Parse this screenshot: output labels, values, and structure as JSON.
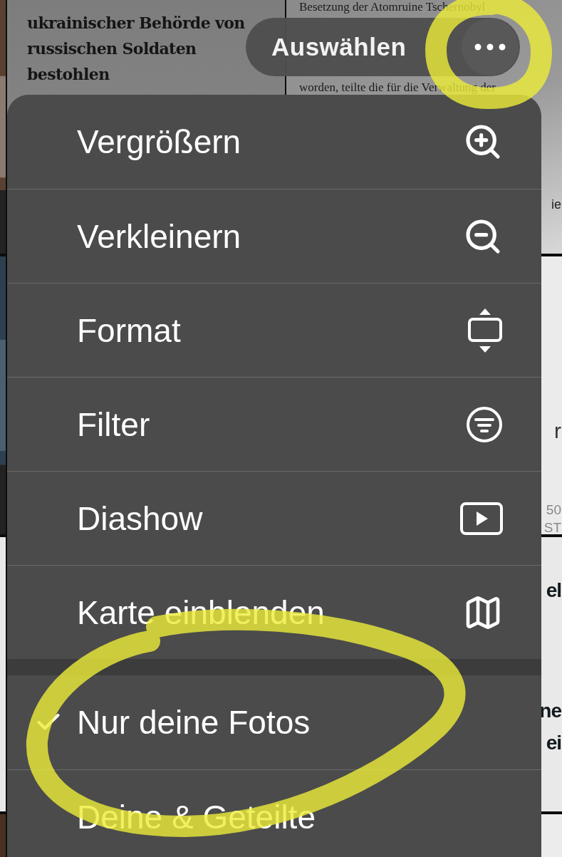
{
  "background": {
    "headline": [
      "ukrainischer Behörde von",
      "russischen Soldaten",
      "bestohlen"
    ],
    "article_lines": [
      "Besetzung der Atomruine Tschernobyl",
      "worden, teilte die für die Verwaltung der"
    ],
    "article_edge": "ie",
    "middle_edge": [
      "r",
      "50",
      "ST"
    ],
    "lower_edge": [
      "el",
      "ne",
      "ei"
    ]
  },
  "top_bar": {
    "select_button": "Auswählen"
  },
  "menu": {
    "actions": [
      {
        "label": "Vergrößern"
      },
      {
        "label": "Verkleinern"
      },
      {
        "label": "Format"
      },
      {
        "label": "Filter"
      },
      {
        "label": "Diashow"
      },
      {
        "label": "Karte einblenden"
      }
    ],
    "library_filter": [
      {
        "label": "Nur deine Fotos",
        "selected": true
      },
      {
        "label": "Deine & Geteilte",
        "selected": false
      }
    ]
  }
}
